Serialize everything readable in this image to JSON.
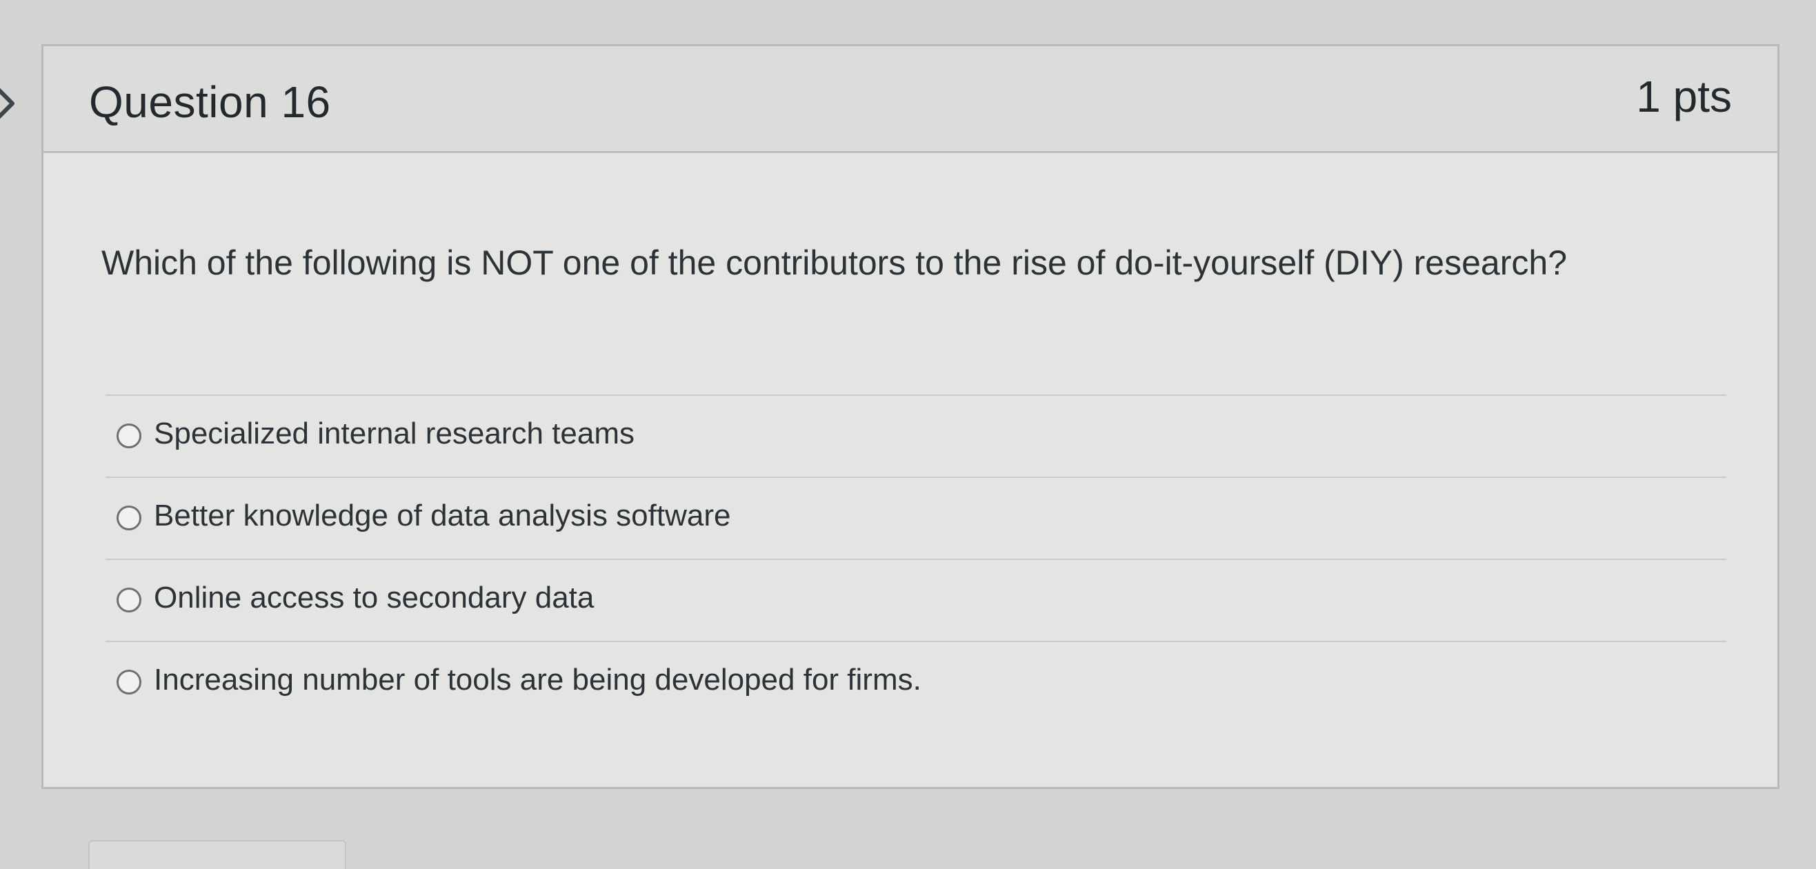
{
  "question": {
    "title": "Question 16",
    "points": "1 pts",
    "text": "Which of the following is NOT one of the contributors to the rise of do-it-yourself (DIY) research?",
    "answers": [
      {
        "label": "Specialized internal research teams",
        "selected": false
      },
      {
        "label": "Better knowledge of data analysis software",
        "selected": false
      },
      {
        "label": "Online access to secondary data",
        "selected": false
      },
      {
        "label": "Increasing number of tools are being developed for firms.",
        "selected": false
      }
    ]
  },
  "icons": {
    "left_chevron": "chevron-right-icon"
  }
}
